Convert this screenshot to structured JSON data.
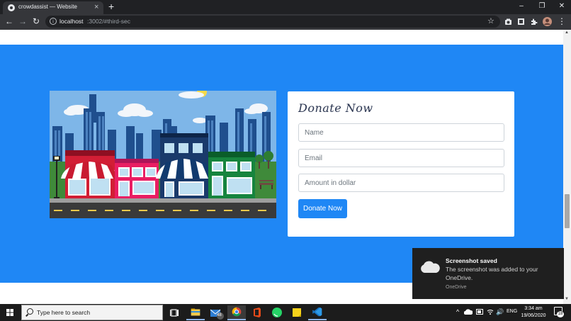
{
  "browser": {
    "tab_title": "crowdassist — Website",
    "tab_close": "×",
    "new_tab": "+",
    "url_host": "localhost",
    "url_path": ":3002/#third-sec",
    "nav": {
      "back": "←",
      "forward": "→",
      "reload": "↻"
    },
    "window_controls": {
      "minimize": "–",
      "maximize": "❐",
      "close": "✕"
    },
    "menu": "⋮"
  },
  "form": {
    "title": "Donate Now",
    "name_placeholder": "Name",
    "email_placeholder": "Email",
    "amount_placeholder": "Amount in dollar",
    "submit_label": "Donate Now"
  },
  "toast": {
    "title": "Screenshot saved",
    "body": "The screenshot was added to your OneDrive.",
    "app": "OneDrive"
  },
  "taskbar": {
    "search_placeholder": "Type here to search",
    "mail_badge": "48",
    "language": "ENG",
    "time": "3:34 am",
    "date": "19/06/2020",
    "notification_count": "18"
  },
  "colors": {
    "section_blue": "#1f87f5",
    "button_blue": "#1f87f5",
    "chrome_dark": "#202124",
    "taskbar": "#1c1c1c"
  }
}
